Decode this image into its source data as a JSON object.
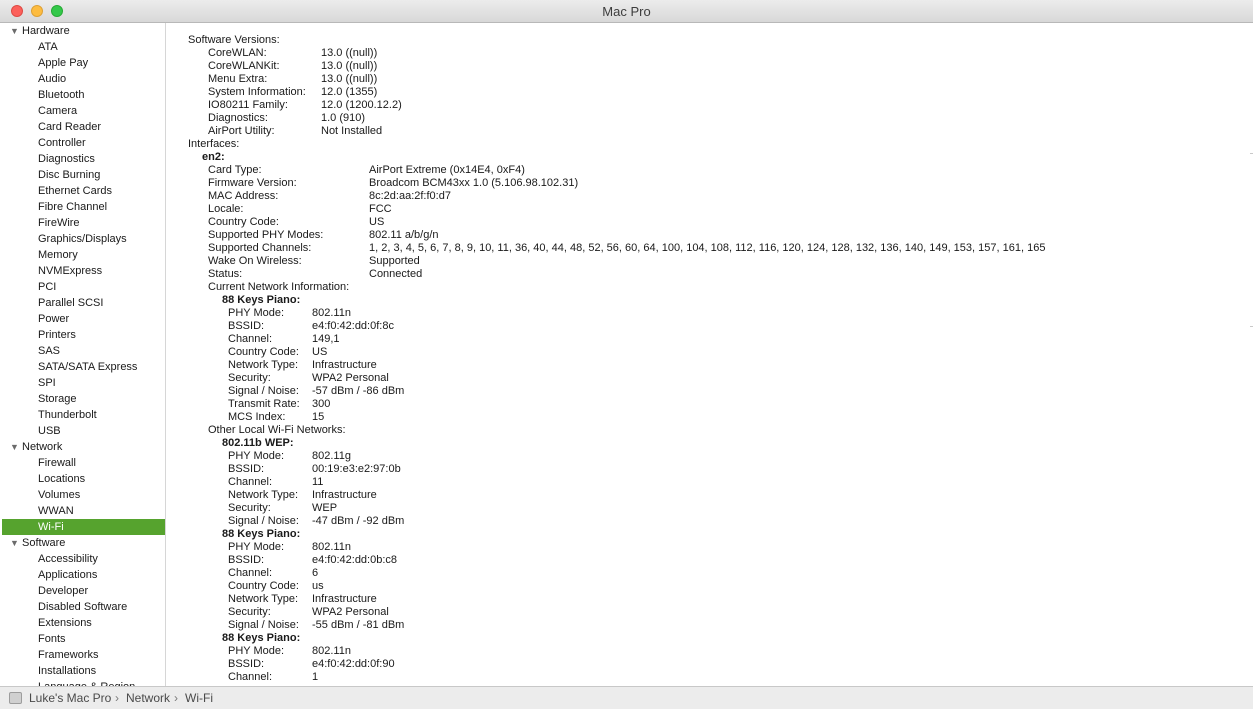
{
  "window": {
    "title": "Mac Pro"
  },
  "sidebar": {
    "groups": [
      {
        "label": "Hardware",
        "items": [
          "ATA",
          "Apple Pay",
          "Audio",
          "Bluetooth",
          "Camera",
          "Card Reader",
          "Controller",
          "Diagnostics",
          "Disc Burning",
          "Ethernet Cards",
          "Fibre Channel",
          "FireWire",
          "Graphics/Displays",
          "Memory",
          "NVMExpress",
          "PCI",
          "Parallel SCSI",
          "Power",
          "Printers",
          "SAS",
          "SATA/SATA Express",
          "SPI",
          "Storage",
          "Thunderbolt",
          "USB"
        ]
      },
      {
        "label": "Network",
        "items": [
          "Firewall",
          "Locations",
          "Volumes",
          "WWAN",
          "Wi-Fi"
        ]
      },
      {
        "label": "Software",
        "items": [
          "Accessibility",
          "Applications",
          "Developer",
          "Disabled Software",
          "Extensions",
          "Fonts",
          "Frameworks",
          "Installations",
          "Language & Region"
        ]
      }
    ],
    "selected": "Wi-Fi"
  },
  "content": {
    "lines": [
      {
        "i": 0,
        "l": "Software Versions:"
      },
      {
        "i": 1,
        "l": "CoreWLAN:",
        "v": "13.0 ((null))"
      },
      {
        "i": 1,
        "l": "CoreWLANKit:",
        "v": "13.0 ((null))"
      },
      {
        "i": 1,
        "l": "Menu Extra:",
        "v": "13.0 ((null))"
      },
      {
        "i": 1,
        "l": "System Information:",
        "v": "12.0 (1355)"
      },
      {
        "i": 1,
        "l": "IO80211 Family:",
        "v": "12.0 (1200.12.2)"
      },
      {
        "i": 1,
        "l": "Diagnostics:",
        "v": "1.0 (910)"
      },
      {
        "i": 1,
        "l": "AirPort Utility:",
        "v": "Not Installed"
      },
      {
        "i": 0,
        "l": "Interfaces:"
      },
      {
        "i": 3,
        "l": "en2:",
        "b": true
      },
      {
        "i": 2,
        "l": "Card Type:",
        "v": "AirPort Extreme  (0x14E4, 0xF4)"
      },
      {
        "i": 2,
        "l": "Firmware Version:",
        "v": "Broadcom BCM43xx 1.0 (5.106.98.102.31)"
      },
      {
        "i": 2,
        "l": "MAC Address:",
        "v": "8c:2d:aa:2f:f0:d7"
      },
      {
        "i": 2,
        "l": "Locale:",
        "v": "FCC"
      },
      {
        "i": 2,
        "l": "Country Code:",
        "v": "US"
      },
      {
        "i": 2,
        "l": "Supported PHY Modes:",
        "v": "802.11 a/b/g/n"
      },
      {
        "i": 2,
        "l": "Supported Channels:",
        "v": "1, 2, 3, 4, 5, 6, 7, 8, 9, 10, 11, 36, 40, 44, 48, 52, 56, 60, 64, 100, 104, 108, 112, 116, 120, 124, 128, 132, 136, 140, 149, 153, 157, 161, 165"
      },
      {
        "i": 2,
        "l": "Wake On Wireless:",
        "v": "Supported"
      },
      {
        "i": 2,
        "l": "Status:",
        "v": "Connected"
      },
      {
        "i": 4,
        "l": "Current Network Information:"
      },
      {
        "i": 5,
        "l": "88 Keys Piano:",
        "b": true
      },
      {
        "i": 6,
        "l": "PHY Mode:",
        "v": "802.11n"
      },
      {
        "i": 6,
        "l": "BSSID:",
        "v": "e4:f0:42:dd:0f:8c"
      },
      {
        "i": 6,
        "l": "Channel:",
        "v": "149,1"
      },
      {
        "i": 6,
        "l": "Country Code:",
        "v": "US"
      },
      {
        "i": 6,
        "l": "Network Type:",
        "v": "Infrastructure"
      },
      {
        "i": 6,
        "l": "Security:",
        "v": "WPA2 Personal"
      },
      {
        "i": 6,
        "l": "Signal / Noise:",
        "v": "-57 dBm / -86 dBm"
      },
      {
        "i": 6,
        "l": "Transmit Rate:",
        "v": "300"
      },
      {
        "i": 6,
        "l": "MCS Index:",
        "v": "15"
      },
      {
        "i": 4,
        "l": "Other Local Wi-Fi Networks:"
      },
      {
        "i": 5,
        "l": "802.11b WEP:",
        "b": true
      },
      {
        "i": 6,
        "l": "PHY Mode:",
        "v": "802.11g"
      },
      {
        "i": 6,
        "l": "BSSID:",
        "v": "00:19:e3:e2:97:0b"
      },
      {
        "i": 6,
        "l": "Channel:",
        "v": "11"
      },
      {
        "i": 6,
        "l": "Network Type:",
        "v": "Infrastructure"
      },
      {
        "i": 6,
        "l": "Security:",
        "v": "WEP"
      },
      {
        "i": 6,
        "l": "Signal / Noise:",
        "v": "-47 dBm / -92 dBm"
      },
      {
        "i": 5,
        "l": "88 Keys Piano:",
        "b": true
      },
      {
        "i": 6,
        "l": "PHY Mode:",
        "v": "802.11n"
      },
      {
        "i": 6,
        "l": "BSSID:",
        "v": "e4:f0:42:dd:0b:c8"
      },
      {
        "i": 6,
        "l": "Channel:",
        "v": "6"
      },
      {
        "i": 6,
        "l": "Country Code:",
        "v": "us"
      },
      {
        "i": 6,
        "l": "Network Type:",
        "v": "Infrastructure"
      },
      {
        "i": 6,
        "l": "Security:",
        "v": "WPA2 Personal"
      },
      {
        "i": 6,
        "l": "Signal / Noise:",
        "v": "-55 dBm / -81 dBm"
      },
      {
        "i": 5,
        "l": "88 Keys Piano:",
        "b": true
      },
      {
        "i": 6,
        "l": "PHY Mode:",
        "v": "802.11n"
      },
      {
        "i": 6,
        "l": "BSSID:",
        "v": "e4:f0:42:dd:0f:90"
      },
      {
        "i": 6,
        "l": "Channel:",
        "v": "1"
      }
    ]
  },
  "statusbar": {
    "crumbs": [
      "Luke's Mac Pro",
      "Network",
      "Wi-Fi"
    ],
    "separator": "›"
  }
}
